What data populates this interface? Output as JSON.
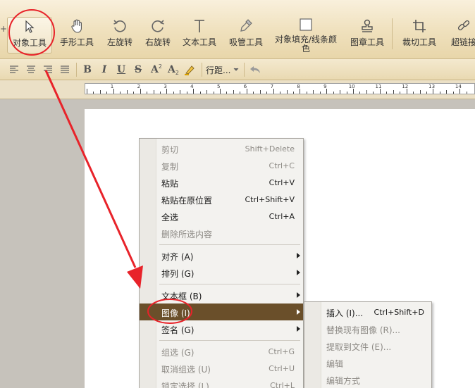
{
  "toolbar": {
    "tools": [
      {
        "label": "对象工具",
        "icon": "pointer-arrow-icon"
      },
      {
        "label": "手形工具",
        "icon": "hand-icon"
      },
      {
        "label": "左旋转",
        "icon": "rotate-left-icon"
      },
      {
        "label": "右旋转",
        "icon": "rotate-right-icon"
      },
      {
        "label": "文本工具",
        "icon": "text-t-icon"
      },
      {
        "label": "吸管工具",
        "icon": "eyedropper-icon"
      },
      {
        "label": "对象填充/线条颜",
        "label2": "色",
        "icon": "fill-square-icon"
      },
      {
        "label": "图章工具",
        "icon": "stamp-icon"
      },
      {
        "label": "裁切工具",
        "icon": "crop-icon"
      },
      {
        "label": "超链接",
        "icon": "link-icon"
      }
    ]
  },
  "formatbar": {
    "bold": "B",
    "italic": "I",
    "underline": "U",
    "strike": "S",
    "superscript": "A",
    "superscript_mark": "2",
    "subscript": "A",
    "subscript_mark": "2",
    "line_spacing": "行距..."
  },
  "ruler": {
    "numbers": [
      "1",
      "2",
      "3",
      "4",
      "5",
      "6",
      "7",
      "8",
      "9",
      "10",
      "11",
      "12",
      "13",
      "14"
    ]
  },
  "context_menu": {
    "items": [
      {
        "label": "剪切",
        "shortcut": "Shift+Delete",
        "enabled": false
      },
      {
        "label": "复制",
        "shortcut": "Ctrl+C",
        "enabled": false
      },
      {
        "label": "粘贴",
        "shortcut": "Ctrl+V",
        "enabled": true
      },
      {
        "label": "粘贴在原位置",
        "shortcut": "Ctrl+Shift+V",
        "enabled": true
      },
      {
        "label": "全选",
        "shortcut": "Ctrl+A",
        "enabled": true
      },
      {
        "label": "删除所选内容",
        "shortcut": "",
        "enabled": false
      },
      {
        "label": "对齐 (A)",
        "shortcut": "",
        "enabled": true,
        "submenu": true
      },
      {
        "label": "排列 (G)",
        "shortcut": "",
        "enabled": true,
        "submenu": true
      },
      {
        "label": "文本框 (B)",
        "shortcut": "",
        "enabled": true,
        "submenu": true
      },
      {
        "label": "图像 (I)",
        "shortcut": "",
        "enabled": true,
        "submenu": true,
        "highlighted": true
      },
      {
        "label": "签名 (G)",
        "shortcut": "",
        "enabled": true,
        "submenu": true
      },
      {
        "label": "组选 (G)",
        "shortcut": "Ctrl+G",
        "enabled": false
      },
      {
        "label": "取消组选 (U)",
        "shortcut": "Ctrl+U",
        "enabled": false
      },
      {
        "label": "锁定选择 (L)",
        "shortcut": "Ctrl+L",
        "enabled": false
      }
    ]
  },
  "image_submenu": {
    "items": [
      {
        "label": "插入 (I)...",
        "shortcut": "Ctrl+Shift+D",
        "enabled": true
      },
      {
        "label": "替换现有图像 (R)...",
        "shortcut": "",
        "enabled": false
      },
      {
        "label": "提取到文件 (E)...",
        "shortcut": "",
        "enabled": false
      },
      {
        "label": "编辑",
        "shortcut": "",
        "enabled": false
      },
      {
        "label": "编辑方式",
        "shortcut": "",
        "enabled": false
      }
    ]
  },
  "colors": {
    "highlight": "#6a4f2a",
    "annotation_red": "#e8232a",
    "toolbar_bg": "#f2e5c5"
  }
}
